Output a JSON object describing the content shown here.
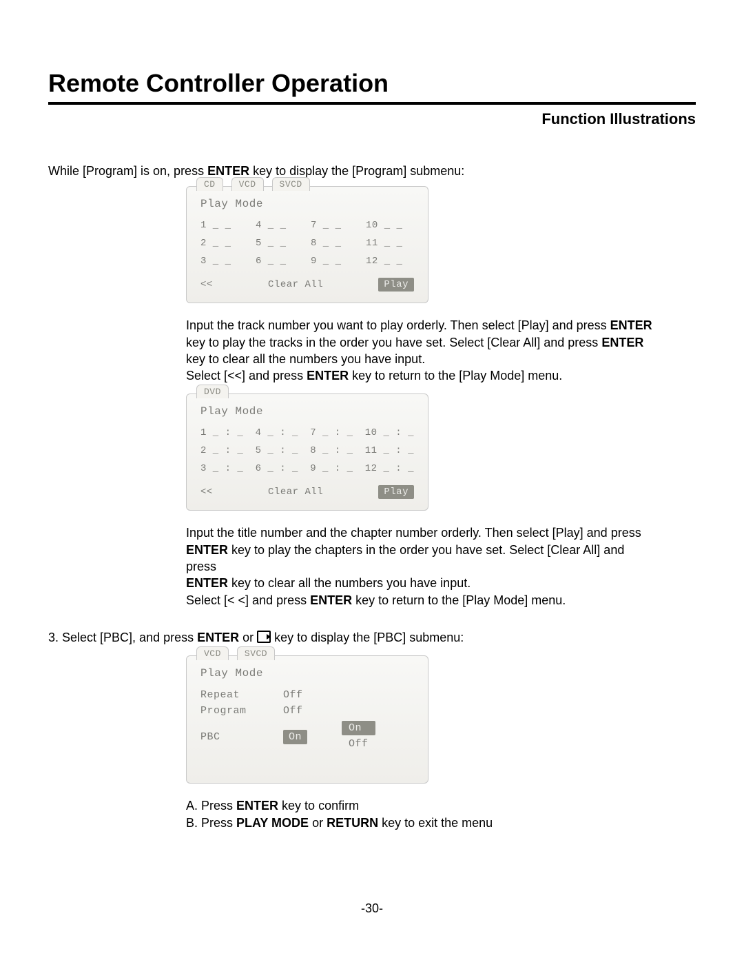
{
  "header": {
    "title": "Remote Controller Operation",
    "subtitle": "Function Illustrations"
  },
  "intro": {
    "pre": "While [Program] is on, press ",
    "bold": "ENTER",
    "post": " key to display the [Program] submenu:"
  },
  "screen1": {
    "tabs": [
      "CD",
      "VCD",
      "SVCD"
    ],
    "title": "Play Mode",
    "cells": [
      "1 _ _",
      "4 _ _",
      "7 _ _",
      "10 _ _",
      "2 _ _",
      "5 _ _",
      "8 _ _",
      "11 _ _",
      "3 _ _",
      "6 _ _",
      "9 _ _",
      "12 _ _"
    ],
    "back": "<<",
    "clear": "Clear All",
    "play": "Play"
  },
  "para1": {
    "l1a": "Input the track number you want to play orderly. Then select [Play] and press ",
    "l1b": "ENTER",
    "l2a": "key to play the tracks in the order you have set. Select [Clear All] and press ",
    "l2b": "ENTER",
    "l3": "key to clear all the numbers you have input.",
    "l4a": "Select [<<] and press ",
    "l4b": "ENTER",
    "l4c": " key to return to the [Play Mode] menu."
  },
  "screen2": {
    "tabs": [
      "DVD"
    ],
    "title": "Play Mode",
    "cells": [
      "1 _ : _",
      "4 _ : _",
      "7 _ : _",
      "10 _ : _",
      "2 _ : _",
      "5 _ : _",
      "8 _ : _",
      "11 _ : _",
      "3 _ : _",
      "6 _ : _",
      "9 _ : _",
      "12 _ : _"
    ],
    "back": "<<",
    "clear": "Clear All",
    "play": "Play"
  },
  "para2": {
    "l1": "Input the title number and the chapter number orderly. Then select [Play] and press",
    "l2a": "ENTER",
    "l2b": " key to play the chapters in the order you have set. Select [Clear All] and press",
    "l3a": "ENTER",
    "l3b": " key to clear all the numbers you have input.",
    "l4a": "Select [< <] and press ",
    "l4b": "ENTER",
    "l4c": " key to return to the [Play Mode] menu."
  },
  "step3": {
    "a": "3. Select [PBC], and press ",
    "b": "ENTER",
    "c": " or ",
    "d": " key to display the [PBC] submenu:"
  },
  "screen3": {
    "tabs": [
      "VCD",
      "SVCD"
    ],
    "title": "Play Mode",
    "rows": [
      {
        "label": "Repeat",
        "value": "Off"
      },
      {
        "label": "Program",
        "value": "Off"
      },
      {
        "label": "PBC",
        "value": "On"
      }
    ],
    "drop": {
      "on": "On",
      "off": "Off"
    }
  },
  "tail": {
    "a1": "A. Press ",
    "a2": "ENTER",
    "a3": " key to confirm",
    "b1": "B. Press ",
    "b2": "PLAY MODE",
    "b3": " or ",
    "b4": "RETURN",
    "b5": " key to exit the menu"
  },
  "page_no": "-30-"
}
